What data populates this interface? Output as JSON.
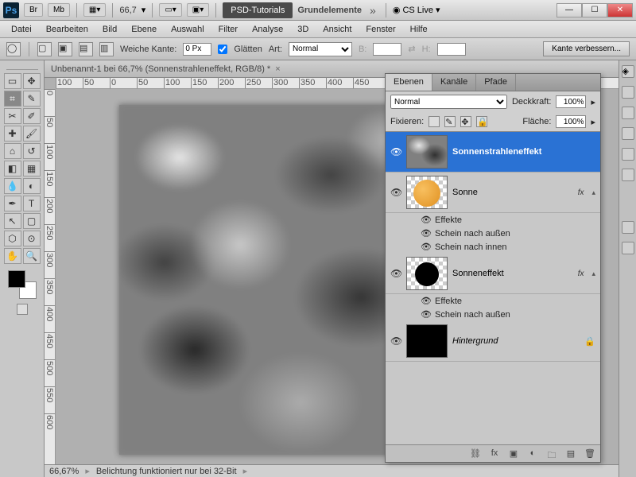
{
  "titlebar": {
    "zoom": "66,7",
    "tab1": "PSD-Tutorials",
    "tab2": "Grundelemente",
    "cslive": "CS Live"
  },
  "menu": [
    "Datei",
    "Bearbeiten",
    "Bild",
    "Ebene",
    "Auswahl",
    "Filter",
    "Analyse",
    "3D",
    "Ansicht",
    "Fenster",
    "Hilfe"
  ],
  "options": {
    "feather_label": "Weiche Kante:",
    "feather_value": "0 Px",
    "antialias_label": "Glätten",
    "style_label": "Art:",
    "style_value": "Normal",
    "width_label": "B:",
    "height_label": "H:",
    "refine": "Kante verbessern..."
  },
  "doc": {
    "tab": "Unbenannt-1 bei 66,7% (Sonnenstrahleneffekt, RGB/8) *"
  },
  "ruler_h": [
    "100",
    "50",
    "0",
    "50",
    "100",
    "150",
    "200",
    "250",
    "300",
    "350",
    "400",
    "450"
  ],
  "ruler_v": [
    "0",
    "50",
    "100",
    "150",
    "200",
    "250",
    "300",
    "350",
    "400",
    "450",
    "500",
    "550",
    "600"
  ],
  "status": {
    "zoom": "66,67%",
    "info": "Belichtung funktioniert nur bei 32-Bit"
  },
  "layers_panel": {
    "tabs": [
      "Ebenen",
      "Kanäle",
      "Pfade"
    ],
    "blend": "Normal",
    "opacity_label": "Deckkraft:",
    "opacity": "100%",
    "lock_label": "Fixieren:",
    "fill_label": "Fläche:",
    "fill": "100%",
    "layers": [
      {
        "name": "Sonnenstrahleneffekt",
        "selected": true,
        "thumb": "clouds"
      },
      {
        "name": "Sonne",
        "thumb": "sun",
        "fx": true
      },
      {
        "name": "Sonneneffekt",
        "thumb": "blackcircle",
        "fx": true
      },
      {
        "name": "Hintergrund",
        "thumb": "black",
        "locked": true,
        "italic": true
      }
    ],
    "effects_label": "Effekte",
    "effect_outer": "Schein nach außen",
    "effect_inner": "Schein nach innen"
  }
}
